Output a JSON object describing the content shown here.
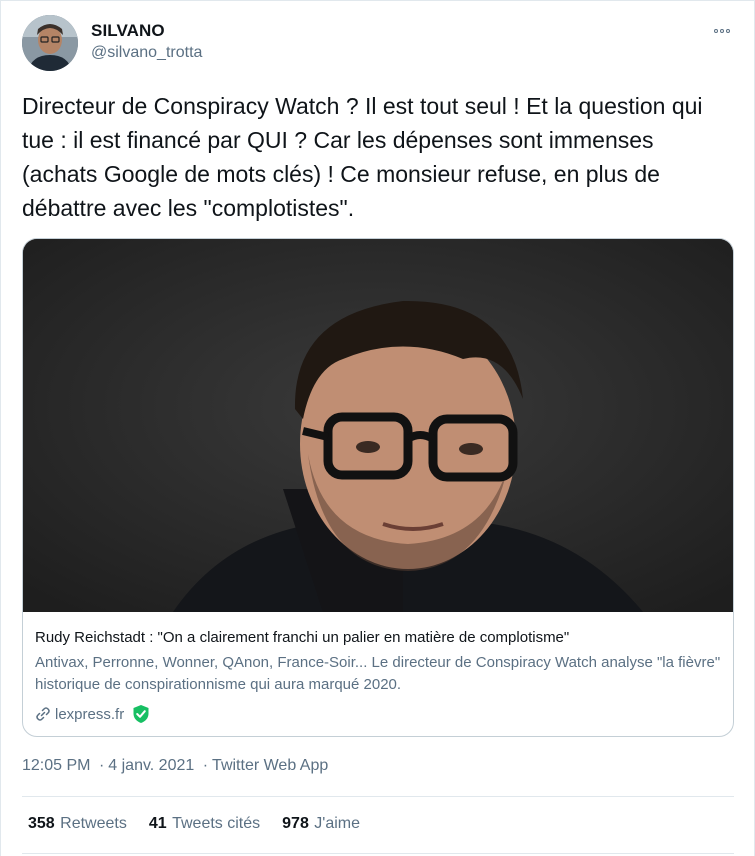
{
  "author": {
    "display_name": "SILVANO",
    "handle": "@silvano_trotta"
  },
  "tweet": {
    "text": "Directeur de Conspiracy Watch ? Il est tout seul ! Et la question qui tue : il est financé par QUI ? Car les dépenses sont immenses (achats Google de mots clés) ! Ce monsieur refuse, en plus de débattre avec les \"complotistes\"."
  },
  "card": {
    "title": "Rudy Reichstadt : \"On a clairement franchi un palier en matière de complotisme\"",
    "description": "Antivax, Perronne, Wonner, QAnon, France-Soir... Le directeur de Conspiracy Watch analyse \"la fièvre\" historique de conspirationnisme qui aura marqué 2020.",
    "domain": "lexpress.fr",
    "image": "man-with-glasses-portrait"
  },
  "meta": {
    "time": "12:05 PM",
    "date": "4 janv. 2021",
    "separator": "·",
    "source": "Twitter Web App"
  },
  "stats": {
    "retweets_count": "358",
    "retweets_label": "Retweets",
    "quotes_count": "41",
    "quotes_label": "Tweets cités",
    "likes_count": "978",
    "likes_label": "J'aime"
  },
  "icons": {
    "more": "more-horizontal-icon",
    "link": "link-icon",
    "verified_domain": "shield-check-icon"
  },
  "colors": {
    "text": "#0f1419",
    "secondary": "#5b7083",
    "border": "#e1e8ed",
    "verified": "#17bf63"
  }
}
